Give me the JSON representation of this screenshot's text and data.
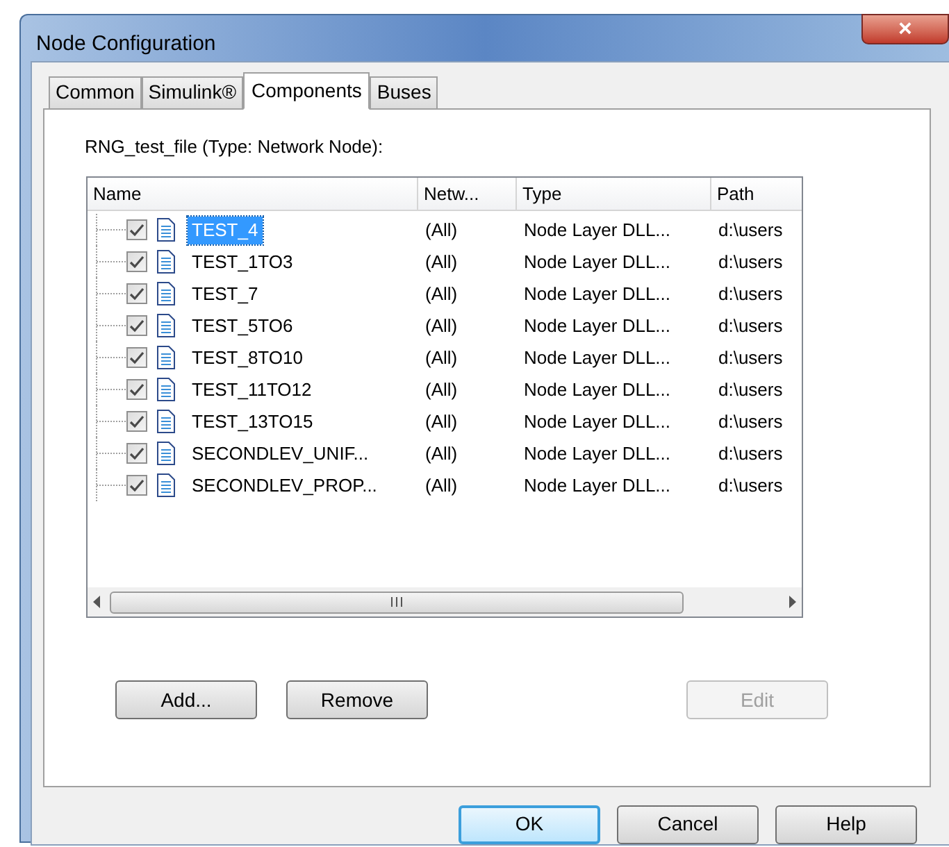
{
  "window": {
    "title": "Node Configuration",
    "close": "×"
  },
  "tabs": [
    {
      "label": "Common",
      "selected": false
    },
    {
      "label": "Simulink®",
      "selected": false
    },
    {
      "label": "Components",
      "selected": true
    },
    {
      "label": "Buses",
      "selected": false
    }
  ],
  "caption": "RNG_test_file (Type: Network Node):",
  "table": {
    "columns": [
      "Name",
      "Netw...",
      "Type",
      "Path"
    ],
    "rows": [
      {
        "name": "TEST_4",
        "network": "(All)",
        "type": "Node Layer DLL...",
        "path": "d:\\users",
        "checked": true,
        "selected": true
      },
      {
        "name": "TEST_1TO3",
        "network": "(All)",
        "type": "Node Layer DLL...",
        "path": "d:\\users",
        "checked": true,
        "selected": false
      },
      {
        "name": "TEST_7",
        "network": "(All)",
        "type": "Node Layer DLL...",
        "path": "d:\\users",
        "checked": true,
        "selected": false
      },
      {
        "name": "TEST_5TO6",
        "network": "(All)",
        "type": "Node Layer DLL...",
        "path": "d:\\users",
        "checked": true,
        "selected": false
      },
      {
        "name": "TEST_8TO10",
        "network": "(All)",
        "type": "Node Layer DLL...",
        "path": "d:\\users",
        "checked": true,
        "selected": false
      },
      {
        "name": "TEST_11TO12",
        "network": "(All)",
        "type": "Node Layer DLL...",
        "path": "d:\\users",
        "checked": true,
        "selected": false
      },
      {
        "name": "TEST_13TO15",
        "network": "(All)",
        "type": "Node Layer DLL...",
        "path": "d:\\users",
        "checked": true,
        "selected": false
      },
      {
        "name": "SECONDLEV_UNIF...",
        "network": "(All)",
        "type": "Node Layer DLL...",
        "path": "d:\\users",
        "checked": true,
        "selected": false
      },
      {
        "name": "SECONDLEV_PROP...",
        "network": "(All)",
        "type": "Node Layer DLL...",
        "path": "d:\\users",
        "checked": true,
        "selected": false
      }
    ]
  },
  "panel_buttons": [
    {
      "label": "Add...",
      "disabled": false
    },
    {
      "label": "Remove",
      "disabled": false
    },
    {
      "label": "Edit",
      "disabled": true
    }
  ],
  "dialog_buttons": [
    {
      "label": "OK",
      "default": true
    },
    {
      "label": "Cancel",
      "default": false
    },
    {
      "label": "Help",
      "default": false
    }
  ]
}
